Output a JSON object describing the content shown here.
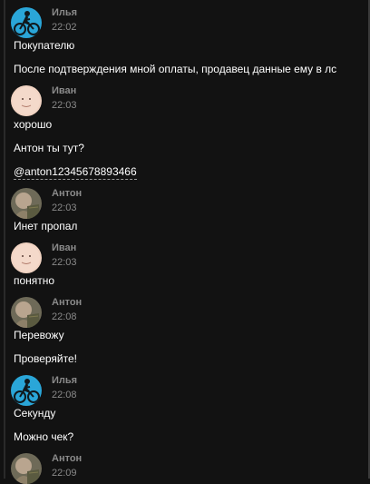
{
  "messages": [
    {
      "author": "Илья",
      "time": "22:02",
      "lines": [
        "Покупателю",
        "После подтверждения мной оплаты, продавец данные ему в лс"
      ]
    },
    {
      "author": "Иван",
      "time": "22:03",
      "lines": [
        "хорошо",
        "Антон ты тут?",
        "@anton12345678893466"
      ]
    },
    {
      "author": "Антон",
      "time": "22:03",
      "lines": [
        "Инет пропал"
      ]
    },
    {
      "author": "Иван",
      "time": "22:03",
      "lines": [
        "понятно"
      ]
    },
    {
      "author": "Антон",
      "time": "22:08",
      "lines": [
        "Перевожу",
        "Проверяйте!"
      ]
    },
    {
      "author": "Илья",
      "time": "22:08",
      "lines": [
        "Секунду",
        "Можно чек?"
      ]
    },
    {
      "author": "Антон",
      "time": "22:09",
      "lines": []
    }
  ],
  "avatars": {
    "ilya": "avatar-cyclist-icon",
    "ivan": "avatar-face-icon",
    "anton": "avatar-photo-icon"
  },
  "colors": {
    "background": "#121212",
    "text": "#ffffff",
    "meta": "#8a8a8a"
  }
}
